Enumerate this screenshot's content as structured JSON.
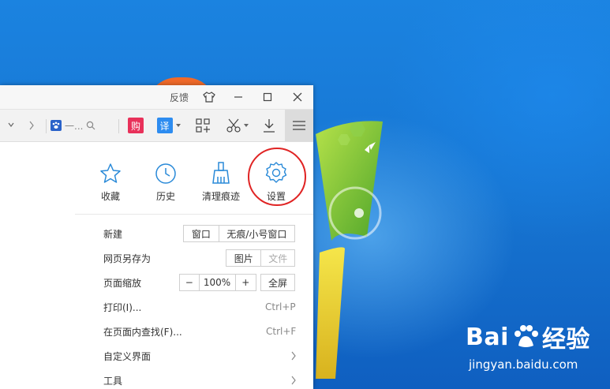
{
  "titlebar": {
    "feedback_label": "反馈",
    "icons": [
      "shirt-icon",
      "minimize-icon",
      "maximize-icon",
      "close-icon"
    ]
  },
  "toolbar": {
    "search_text": "一...",
    "gou_label": "购",
    "translate_label": "译"
  },
  "menu": {
    "quick_actions": [
      {
        "label": "收藏",
        "icon": "star-icon"
      },
      {
        "label": "历史",
        "icon": "clock-icon"
      },
      {
        "label": "清理痕迹",
        "icon": "broom-icon"
      },
      {
        "label": "设置",
        "icon": "gear-icon"
      }
    ],
    "new": {
      "label": "新建",
      "window": "窗口",
      "private_window": "无痕/小号窗口"
    },
    "save_as": {
      "label": "网页另存为",
      "image": "图片",
      "file": "文件"
    },
    "zoom": {
      "label": "页面缩放",
      "minus": "−",
      "value": "100%",
      "plus": "+",
      "fullscreen": "全屏"
    },
    "print": {
      "label": "打印(I)...",
      "shortcut": "Ctrl+P"
    },
    "find": {
      "label": "在页面内查找(F)...",
      "shortcut": "Ctrl+F"
    },
    "customize": {
      "label": "自定义界面"
    },
    "tools": {
      "label": "工具"
    }
  },
  "watermark": {
    "logo_text_a": "Bai",
    "logo_text_b": "经验",
    "url": "jingyan.baidu.com"
  },
  "colors": {
    "accent_blue": "#2a8ad8",
    "gou_red": "#e8315a",
    "translate_blue": "#2d8cf0",
    "highlight_red": "#e02424"
  }
}
